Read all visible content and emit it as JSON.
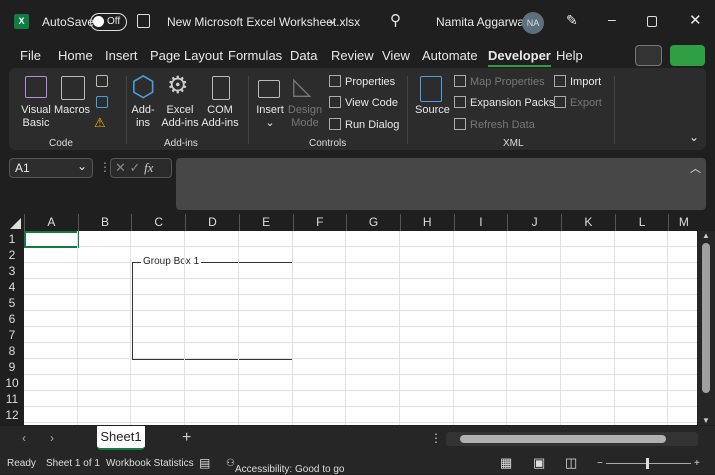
{
  "title": {
    "autosave": "AutoSave",
    "autosave_state": "Off",
    "filename": "New Microsoft Excel Worksheet.xlsx",
    "user": "Namita Aggarwal",
    "initials": "NA"
  },
  "menu": [
    "File",
    "Home",
    "Insert",
    "Page Layout",
    "Formulas",
    "Data",
    "Review",
    "View",
    "Automate",
    "Developer",
    "Help"
  ],
  "active_tab": "Developer",
  "ribbon": {
    "code": {
      "label": "Code",
      "visual_basic": "Visual Basic",
      "macros": "Macros"
    },
    "addins": {
      "label": "Add-ins",
      "addins": "Add-ins",
      "excel_addins": "Excel Add-ins",
      "com_addins": "COM Add-ins"
    },
    "controls": {
      "label": "Controls",
      "insert": "Insert",
      "design_mode": "Design Mode",
      "properties": "Properties",
      "view_code": "View Code",
      "run_dialog": "Run Dialog"
    },
    "xml": {
      "label": "XML",
      "source": "Source",
      "map_properties": "Map Properties",
      "expansion_packs": "Expansion Packs",
      "refresh_data": "Refresh Data",
      "import": "Import",
      "export": "Export"
    }
  },
  "formula": {
    "name_box": "A1",
    "fx": "fx",
    "value": ""
  },
  "columns": [
    "A",
    "B",
    "C",
    "D",
    "E",
    "F",
    "G",
    "H",
    "I",
    "J",
    "K",
    "L",
    "M"
  ],
  "rows": [
    "1",
    "2",
    "3",
    "4",
    "5",
    "6",
    "7",
    "8",
    "9",
    "10",
    "11",
    "12"
  ],
  "group_box": "Group Box 1",
  "sheets": [
    "Sheet1"
  ],
  "status": {
    "ready": "Ready",
    "sheet_of": "Sheet 1 of 1",
    "stats": "Workbook Statistics",
    "accessibility": "Accessibility: Good to go"
  },
  "colors": {
    "accent": "#107c41",
    "share": "#2ea043"
  }
}
